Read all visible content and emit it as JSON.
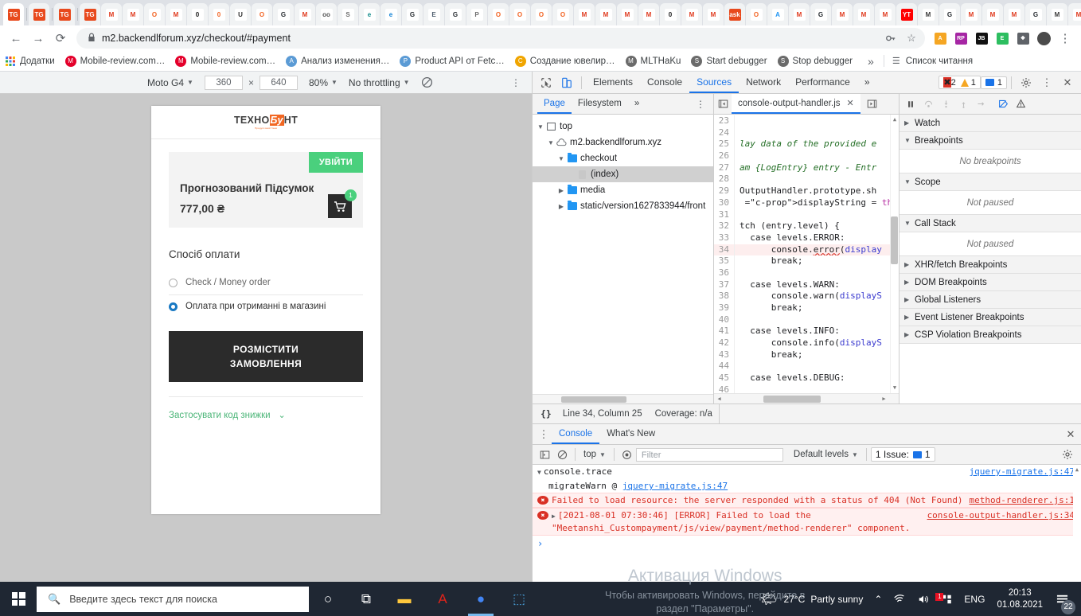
{
  "browser": {
    "tabs": [
      {
        "icon": "TG",
        "bg": "#e8491d",
        "fg": "#ffffff",
        "active": true
      },
      {
        "icon": "TG",
        "bg": "#e8491d",
        "fg": "#ffffff"
      },
      {
        "icon": "TG",
        "bg": "#e8491d",
        "fg": "#ffffff"
      },
      {
        "icon": "TG",
        "bg": "#e8491d",
        "fg": "#ffffff"
      },
      {
        "icon": "M",
        "bg": "#ffffff",
        "fg": "#e03a1e"
      },
      {
        "icon": "M",
        "bg": "#ffffff",
        "fg": "#e03a1e"
      },
      {
        "icon": "O",
        "bg": "#ffffff",
        "fg": "#f26322"
      },
      {
        "icon": "M",
        "bg": "#ffffff",
        "fg": "#e03a1e"
      },
      {
        "icon": "0",
        "bg": "#ffffff",
        "fg": "#1a1a1a"
      },
      {
        "icon": "0",
        "bg": "#ffffff",
        "fg": "#f26322"
      },
      {
        "icon": "U",
        "bg": "#ffffff",
        "fg": "#2b2b2b"
      },
      {
        "icon": "O",
        "bg": "#ffffff",
        "fg": "#f26322"
      },
      {
        "icon": "G",
        "bg": "#ffffff",
        "fg": "#24292e"
      },
      {
        "icon": "M",
        "bg": "#ffffff",
        "fg": "#e03a1e"
      },
      {
        "icon": "oo",
        "bg": "#ffffff",
        "fg": "#555555"
      },
      {
        "icon": "S",
        "bg": "#ffffff",
        "fg": "#6f6f6f"
      },
      {
        "icon": "e",
        "bg": "#ffffff",
        "fg": "#0f8a8a"
      },
      {
        "icon": "e",
        "bg": "#ffffff",
        "fg": "#0b7fd4"
      },
      {
        "icon": "G",
        "bg": "#ffffff",
        "fg": "#24292e"
      },
      {
        "icon": "E",
        "bg": "#ffffff",
        "fg": "#4a5a6a"
      },
      {
        "icon": "G",
        "bg": "#ffffff",
        "fg": "#24292e"
      },
      {
        "icon": "P",
        "bg": "#ffffff",
        "fg": "#6b6b6b"
      },
      {
        "icon": "O",
        "bg": "#ffffff",
        "fg": "#f26322"
      },
      {
        "icon": "O",
        "bg": "#ffffff",
        "fg": "#f26322"
      },
      {
        "icon": "O",
        "bg": "#ffffff",
        "fg": "#f26322"
      },
      {
        "icon": "O",
        "bg": "#ffffff",
        "fg": "#f26322"
      },
      {
        "icon": "M",
        "bg": "#ffffff",
        "fg": "#e03a1e"
      },
      {
        "icon": "M",
        "bg": "#ffffff",
        "fg": "#e03a1e"
      },
      {
        "icon": "M",
        "bg": "#ffffff",
        "fg": "#e03a1e"
      },
      {
        "icon": "M",
        "bg": "#ffffff",
        "fg": "#e03a1e"
      },
      {
        "icon": "0",
        "bg": "#ffffff",
        "fg": "#1a1a1a"
      },
      {
        "icon": "M",
        "bg": "#ffffff",
        "fg": "#e03a1e"
      },
      {
        "icon": "M",
        "bg": "#ffffff",
        "fg": "#e03a1e"
      },
      {
        "icon": "ask",
        "bg": "#e8491d",
        "fg": "#ffffff"
      },
      {
        "icon": "O",
        "bg": "#ffffff",
        "fg": "#f26322"
      },
      {
        "icon": "A",
        "bg": "#ffffff",
        "fg": "#2196f3"
      },
      {
        "icon": "M",
        "bg": "#ffffff",
        "fg": "#e03a1e"
      },
      {
        "icon": "G",
        "bg": "#ffffff",
        "fg": "#24292e"
      },
      {
        "icon": "M",
        "bg": "#ffffff",
        "fg": "#e03a1e"
      },
      {
        "icon": "M",
        "bg": "#ffffff",
        "fg": "#e03a1e"
      },
      {
        "icon": "M",
        "bg": "#ffffff",
        "fg": "#e03a1e"
      },
      {
        "icon": "YT",
        "bg": "#ff0000",
        "fg": "#ffffff"
      },
      {
        "icon": "M",
        "bg": "#ffffff",
        "fg": "#3a3a3a"
      },
      {
        "icon": "G",
        "bg": "#ffffff",
        "fg": "#24292e"
      },
      {
        "icon": "M",
        "bg": "#ffffff",
        "fg": "#e03a1e"
      },
      {
        "icon": "M",
        "bg": "#ffffff",
        "fg": "#e03a1e"
      },
      {
        "icon": "M",
        "bg": "#ffffff",
        "fg": "#e03a1e"
      },
      {
        "icon": "G",
        "bg": "#ffffff",
        "fg": "#24292e"
      },
      {
        "icon": "M",
        "bg": "#ffffff",
        "fg": "#3a3a3a"
      },
      {
        "icon": "M",
        "bg": "#ffffff",
        "fg": "#e03a1e"
      },
      {
        "icon": "M",
        "bg": "#ffffff",
        "fg": "#e03a1e"
      },
      {
        "icon": "M",
        "bg": "#ffffff",
        "fg": "#e03a1e"
      },
      {
        "icon": "O",
        "bg": "#ffffff",
        "fg": "#f26322"
      },
      {
        "icon": "O",
        "bg": "#ffffff",
        "fg": "#f26322"
      }
    ],
    "new_tab_label": "+",
    "window_buttons": {
      "minimize": "─",
      "maximize": "❐",
      "close": "✕"
    },
    "nav": {
      "back": "←",
      "forward": "→",
      "reload": "⟳"
    },
    "omnibox": {
      "lock_icon": "lock-icon",
      "url": "m2.backendlforum.xyz/checkout/#payment",
      "key_icon": "key-icon",
      "star_icon": "star-icon"
    },
    "extensions": [
      {
        "name": "adguard-extension",
        "label": "A",
        "bg": "#f5a623"
      },
      {
        "name": "ripple-extension",
        "label": "RP",
        "bg": "#a626a4"
      },
      {
        "name": "jetbrains-extension",
        "label": "JB",
        "bg": "#111111"
      },
      {
        "name": "evernote-extension",
        "label": "E",
        "bg": "#2dbe60"
      },
      {
        "name": "puzzle-extension",
        "label": "❖",
        "bg": "#5f6368"
      },
      {
        "name": "profile-avatar",
        "label": "",
        "bg": "#4b4b4b"
      }
    ],
    "menu_icon": "⋮",
    "bookmarks": [
      {
        "label": "Додатки",
        "icon": "apps-grid-icon",
        "bg": "grid"
      },
      {
        "label": "Mobile-review.com…",
        "icon": "opera-icon",
        "bg": "#e4002b"
      },
      {
        "label": "Mobile-review.com…",
        "icon": "opera-icon",
        "bg": "#e4002b"
      },
      {
        "label": "Анализ изменения…",
        "icon": "bug-icon",
        "bg": "#5b9bd5"
      },
      {
        "label": "Product API от Fetc…",
        "icon": "bug-icon",
        "bg": "#5b9bd5"
      },
      {
        "label": "Создание ювелир…",
        "icon": "basket-icon",
        "bg": "#f0a500"
      },
      {
        "label": "MLTHaKu",
        "icon": "globe-icon",
        "bg": "#6b6b6b"
      },
      {
        "label": "Start debugger",
        "icon": "globe-icon",
        "bg": "#6b6b6b"
      },
      {
        "label": "Stop debugger",
        "icon": "globe-icon",
        "bg": "#6b6b6b"
      }
    ],
    "bookmarks_overflow": "»",
    "reading_list": {
      "label": "Список читання",
      "icon": "reading-list-icon"
    }
  },
  "device_toolbar": {
    "device": "Moto G4",
    "width": "360",
    "height": "640",
    "multiply": "×",
    "zoom": "80%",
    "throttling": "No throttling",
    "rotate_icon": "rotate-icon",
    "more_icon": "⋮"
  },
  "page": {
    "logo": {
      "text_left": "ТЕХНО",
      "text_hl": "Бу",
      "text_right": "НТ",
      "tagline": "Продуктовий банк"
    },
    "login_button": "УВІЙТИ",
    "summary_title": "Прогнозований Підсумок",
    "summary_price": "777,00 ₴",
    "cart_icon": "cart-icon",
    "cart_count": "1",
    "payment_title": "Спосіб оплати",
    "payment_methods": [
      {
        "label": "Check / Money order",
        "selected": false
      },
      {
        "label": "Оплата при отриманні в магазині",
        "selected": true
      }
    ],
    "order_button_line1": "РОЗМІСТИТИ",
    "order_button_line2": "ЗАМОВЛЕННЯ",
    "discount_label": "Застосувати код знижки",
    "discount_chevron": "⌄"
  },
  "devtools": {
    "inspect_icon": "inspect-icon",
    "device_icon": "device-toggle-icon",
    "tabs": [
      {
        "label": "Elements",
        "active": false
      },
      {
        "label": "Console",
        "active": false
      },
      {
        "label": "Sources",
        "active": true
      },
      {
        "label": "Network",
        "active": false
      },
      {
        "label": "Performance",
        "active": false
      }
    ],
    "tabs_overflow": "»",
    "errors_count": "2",
    "warnings_count": "1",
    "messages_count": "1",
    "settings_icon": "gear-icon",
    "more_icon": "⋮",
    "close_icon": "✕",
    "debug_controls": {
      "pause": "❚❚",
      "step_over": "↷",
      "step_into": "↓",
      "step_out": "↑",
      "step": "→",
      "deactivate": "deactivate-breakpoints-icon",
      "pause_exceptions": "pause-on-exceptions-icon"
    },
    "navigator": {
      "tabs": [
        {
          "label": "Page",
          "active": true
        },
        {
          "label": "Filesystem",
          "active": false
        }
      ],
      "overflow": "»",
      "more_icon": "⋮",
      "tree": [
        {
          "label": "top",
          "depth": 0,
          "twisty": "▼",
          "icon": "frame-icon",
          "selected": false
        },
        {
          "label": "m2.backendlforum.xyz",
          "depth": 1,
          "twisty": "▼",
          "icon": "cloud-icon",
          "selected": false
        },
        {
          "label": "checkout",
          "depth": 2,
          "twisty": "▼",
          "icon": "folder-icon",
          "selected": false
        },
        {
          "label": "(index)",
          "depth": 3,
          "twisty": "",
          "icon": "file-icon",
          "selected": true
        },
        {
          "label": "media",
          "depth": 2,
          "twisty": "▶",
          "icon": "folder-icon",
          "selected": false
        },
        {
          "label": "static/version1627833944/front",
          "depth": 2,
          "twisty": "▶",
          "icon": "folder-icon",
          "selected": false
        }
      ]
    },
    "editor": {
      "prev_icon": "◀|",
      "next_icon": "|▶",
      "tab_name": "console-output-handler.js",
      "tab_close": "✕",
      "lines": [
        {
          "n": "23",
          "text": "",
          "kind": "plain"
        },
        {
          "n": "24",
          "text": "",
          "kind": "plain"
        },
        {
          "n": "25",
          "text": "lay data of the provided e",
          "kind": "comment"
        },
        {
          "n": "26",
          "text": "",
          "kind": "plain"
        },
        {
          "n": "27",
          "text": "am {LogEntry} entry - Entr",
          "kind": "comment"
        },
        {
          "n": "28",
          "text": "",
          "kind": "plain"
        },
        {
          "n": "29",
          "text": "OutputHandler.prototype.sh",
          "kind": "prop"
        },
        {
          "n": "30",
          "text": " displayString = this.form",
          "kind": "assign"
        },
        {
          "n": "31",
          "text": "",
          "kind": "plain"
        },
        {
          "n": "32",
          "text": "tch (entry.level) {",
          "kind": "plain"
        },
        {
          "n": "33",
          "text": "  case levels.ERROR:",
          "kind": "case"
        },
        {
          "n": "34",
          "text": "      console.error(display",
          "kind": "callerr",
          "highlight": true
        },
        {
          "n": "35",
          "text": "      break;",
          "kind": "kw"
        },
        {
          "n": "36",
          "text": "",
          "kind": "plain"
        },
        {
          "n": "37",
          "text": "  case levels.WARN:",
          "kind": "case"
        },
        {
          "n": "38",
          "text": "      console.warn(displayS",
          "kind": "call"
        },
        {
          "n": "39",
          "text": "      break;",
          "kind": "kw"
        },
        {
          "n": "40",
          "text": "",
          "kind": "plain"
        },
        {
          "n": "41",
          "text": "  case levels.INFO:",
          "kind": "case"
        },
        {
          "n": "42",
          "text": "      console.info(displayS",
          "kind": "call"
        },
        {
          "n": "43",
          "text": "      break;",
          "kind": "kw"
        },
        {
          "n": "44",
          "text": "",
          "kind": "plain"
        },
        {
          "n": "45",
          "text": "  case levels.DEBUG:",
          "kind": "case"
        },
        {
          "n": "46",
          "text": "",
          "kind": "plain"
        }
      ]
    },
    "debugger_panes": [
      {
        "label": "Watch",
        "expanded": false,
        "body": null
      },
      {
        "label": "Breakpoints",
        "expanded": true,
        "body": "No breakpoints"
      },
      {
        "label": "Scope",
        "expanded": true,
        "body": "Not paused"
      },
      {
        "label": "Call Stack",
        "expanded": true,
        "body": "Not paused"
      },
      {
        "label": "XHR/fetch Breakpoints",
        "expanded": false,
        "body": null
      },
      {
        "label": "DOM Breakpoints",
        "expanded": false,
        "body": null
      },
      {
        "label": "Global Listeners",
        "expanded": false,
        "body": null
      },
      {
        "label": "Event Listener Breakpoints",
        "expanded": false,
        "body": null
      },
      {
        "label": "CSP Violation Breakpoints",
        "expanded": false,
        "body": null
      }
    ],
    "status_bar": {
      "format_icon": "{}",
      "position": "Line 34, Column 25",
      "coverage": "Coverage: n/a"
    },
    "console": {
      "more_icon": "⋮",
      "tabs": [
        {
          "label": "Console",
          "active": true
        },
        {
          "label": "What's New",
          "active": false
        }
      ],
      "close_icon": "✕",
      "sidebar_icon": "console-sidebar-icon",
      "clear_icon": "clear-console-icon",
      "context": "top",
      "eye_icon": "live-expression-icon",
      "filter_placeholder": "Filter",
      "levels": "Default levels",
      "issues_label": "1 Issue:",
      "issues_count": "1",
      "settings_icon": "gear-icon",
      "messages": [
        {
          "type": "trace",
          "twisty": "▼",
          "text": "console.trace",
          "source": "jquery-migrate.js:47"
        },
        {
          "type": "tracerow",
          "text": "migrateWarn @ ",
          "link": "jquery-migrate.js:47"
        },
        {
          "type": "error",
          "icon": "✖",
          "text": "Failed to load resource: the server responded with a status of 404 (Not Found)",
          "source": "method-renderer.js:1"
        },
        {
          "type": "error",
          "icon": "✖",
          "twisty": "▶",
          "text": "[2021-08-01 07:30:46] [ERROR] Failed to load the \"Meetanshi_Custompayment/js/view/payment/method-renderer\" component.",
          "source": "console-output-handler.js:34"
        }
      ],
      "prompt": "›"
    }
  },
  "watermark": {
    "line1": "Активация Windows",
    "line2": "Чтобы активировать Windows, перейдите в",
    "line3": "раздел \"Параметры\"."
  },
  "taskbar": {
    "start_icon": "windows-start-icon",
    "search_placeholder": "Введите здесь текст для поиска",
    "search_icon": "search-icon",
    "items": [
      {
        "name": "cortana-icon",
        "glyph": "○",
        "color": "#ffffff"
      },
      {
        "name": "task-view-icon",
        "glyph": "⧉",
        "color": "#ffffff"
      },
      {
        "name": "file-explorer-icon",
        "glyph": "▬",
        "color": "#ffc83d"
      },
      {
        "name": "acrobat-reader-icon",
        "glyph": "A",
        "color": "#e2231a"
      },
      {
        "name": "chrome-icon",
        "glyph": "●",
        "color": "#4285f4",
        "active": true
      },
      {
        "name": "remote-desktop-icon",
        "glyph": "⬚",
        "color": "#4aa3df"
      }
    ],
    "tray": {
      "weather_icon": "partly-sunny-icon",
      "temperature": "27°C",
      "condition": "Partly sunny",
      "chevron": "⌃",
      "wifi_icon": "wifi-icon",
      "volume_icon": "volume-icon",
      "updates_icon": "windows-update-icon",
      "updates_badge": "1",
      "language": "ENG",
      "time": "20:13",
      "date": "01.08.2021",
      "notifications_icon": "notifications-icon",
      "notifications_count": "22"
    }
  }
}
